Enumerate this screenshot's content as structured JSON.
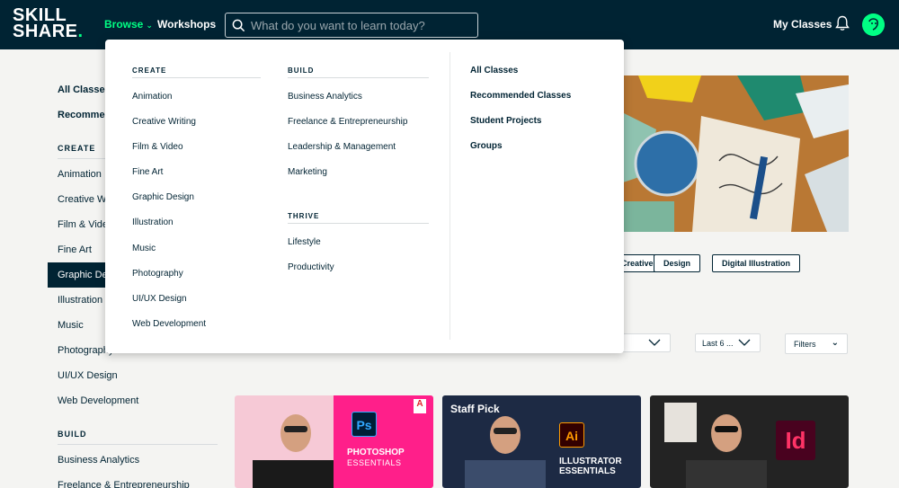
{
  "topbar": {
    "logo_line1": "SKILL",
    "logo_line2": "SHARE",
    "browse": "Browse",
    "workshops": "Workshops",
    "search_placeholder": "What do you want to learn today?",
    "my_classes": "My Classes"
  },
  "sidebar": {
    "links": [
      "All Classes",
      "Recommended Classes"
    ],
    "create_heading": "CREATE",
    "create_items": [
      "Animation",
      "Creative Writing",
      "Film & Video",
      "Fine Art",
      "Graphic Design",
      "Illustration",
      "Music",
      "Photography",
      "UI/UX Design",
      "Web Development"
    ],
    "active_item": "Graphic Design",
    "build_heading": "BUILD",
    "build_items": [
      "Business Analytics",
      "Freelance & Entrepreneurship"
    ]
  },
  "main": {
    "chips": [
      "Creative",
      "Design",
      "Digital Illustration"
    ],
    "sort_select": "",
    "date_select": "Last 6 ...",
    "filters": "Filters",
    "cards": [
      {
        "label": "",
        "title_line1": "PHOTOSHOP",
        "title_line2": "ESSENTIALS",
        "badge": "Ps"
      },
      {
        "label": "Staff Pick",
        "title_line1": "ILLUSTRATOR",
        "title_line2": "ESSENTIALS",
        "badge": "Ai"
      },
      {
        "label": "",
        "title_line1": "",
        "title_line2": "",
        "badge": "Id"
      }
    ]
  },
  "dropdown": {
    "create_heading": "CREATE",
    "create_items": [
      "Animation",
      "Creative Writing",
      "Film & Video",
      "Fine Art",
      "Graphic Design",
      "Illustration",
      "Music",
      "Photography",
      "UI/UX Design",
      "Web Development"
    ],
    "build_heading": "BUILD",
    "build_items": [
      "Business Analytics",
      "Freelance & Entrepreneurship",
      "Leadership & Management",
      "Marketing"
    ],
    "thrive_heading": "THRIVE",
    "thrive_items": [
      "Lifestyle",
      "Productivity"
    ],
    "quick_links": [
      "All Classes",
      "Recommended Classes",
      "Student Projects",
      "Groups"
    ]
  },
  "colors": {
    "navy": "#002333",
    "accent_green": "#00ff84",
    "photoshop": "#31a8ff",
    "illustrator": "#ff9a00",
    "indesign": "#ff3366"
  },
  "icons": [
    "search-icon",
    "chevron-down-icon",
    "bell-icon",
    "avatar-icon",
    "adobe-logo-icon"
  ]
}
